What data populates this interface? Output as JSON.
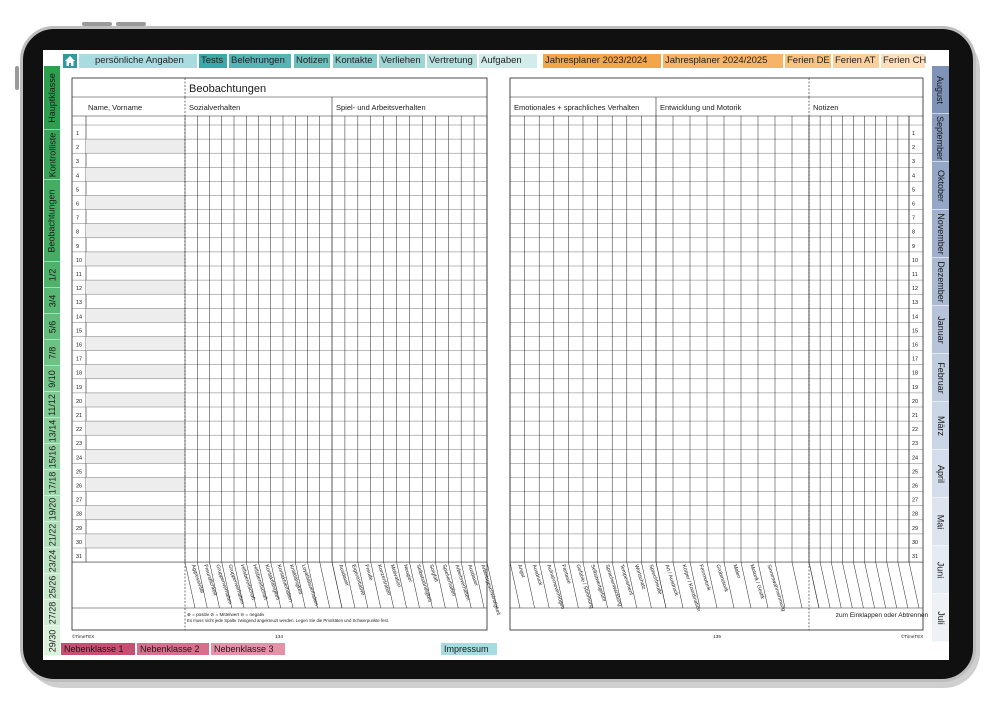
{
  "tabs_top": [
    {
      "label": "persönliche Angaben",
      "color": "#a9dce0"
    },
    {
      "label": "Tests",
      "color": "#39a9a9"
    },
    {
      "label": "Belehrungen",
      "color": "#55b5b5"
    },
    {
      "label": "Notizen",
      "color": "#6bc0bc"
    },
    {
      "label": "Kontakte",
      "color": "#86cbc9"
    },
    {
      "label": "Verliehen",
      "color": "#9fd6d4"
    },
    {
      "label": "Vertretung",
      "color": "#b8e0df"
    },
    {
      "label": "Aufgaben",
      "color": "#d2eceb"
    },
    {
      "label": "Jahresplaner 2023/2024",
      "color": "#f4a54a"
    },
    {
      "label": "Jahresplaner 2024/2025",
      "color": "#f7b466"
    },
    {
      "label": "Ferien DE",
      "color": "#f8c281"
    },
    {
      "label": "Ferien AT",
      "color": "#fad09d"
    },
    {
      "label": "Ferien CH",
      "color": "#fcdfbc"
    }
  ],
  "tabs_left": [
    {
      "label": "Hauptklasse",
      "color": "#2e9e4f"
    },
    {
      "label": "Kontrolliste",
      "color": "#3aa55a"
    },
    {
      "label": "Beobachtungen",
      "color": "#45ac63"
    },
    {
      "label": "1/2",
      "color": "#4eb26b"
    },
    {
      "label": "3/4",
      "color": "#58b773"
    },
    {
      "label": "5/6",
      "color": "#62bc7b"
    },
    {
      "label": "7/8",
      "color": "#6cc183"
    },
    {
      "label": "9/10",
      "color": "#76c68b"
    },
    {
      "label": "11/12",
      "color": "#80cb93"
    },
    {
      "label": "13/14",
      "color": "#8ad09b"
    },
    {
      "label": "15/16",
      "color": "#94d4a3"
    },
    {
      "label": "17/18",
      "color": "#9ed9ab"
    },
    {
      "label": "19/20",
      "color": "#a8ddb3"
    },
    {
      "label": "21/22",
      "color": "#b2e1bb"
    },
    {
      "label": "23/24",
      "color": "#bce5c3"
    },
    {
      "label": "25/26",
      "color": "#c6e9cb"
    },
    {
      "label": "27/28",
      "color": "#d0edd3"
    },
    {
      "label": "29/30",
      "color": "#daf1db"
    }
  ],
  "tabs_right": [
    {
      "label": "August",
      "color": "#7f93b8"
    },
    {
      "label": "September",
      "color": "#8a9dbf"
    },
    {
      "label": "Oktober",
      "color": "#95a7c6"
    },
    {
      "label": "November",
      "color": "#a0b0cc"
    },
    {
      "label": "Dezember",
      "color": "#abbad3"
    },
    {
      "label": "Januar",
      "color": "#b6c3d9"
    },
    {
      "label": "Februar",
      "color": "#c0cddf"
    },
    {
      "label": "März",
      "color": "#cad5e5"
    },
    {
      "label": "April",
      "color": "#d3ddeb"
    },
    {
      "label": "Mai",
      "color": "#dce4ef"
    },
    {
      "label": "Juni",
      "color": "#e5ebf3"
    },
    {
      "label": "Juli",
      "color": "#eef2f7"
    }
  ],
  "tabs_bottom": [
    {
      "label": "Nebenklasse 1",
      "color": "#c94f72"
    },
    {
      "label": "Nebenklasse 2",
      "color": "#d86f8c"
    },
    {
      "label": "Nebenklasse 3",
      "color": "#e592a8"
    },
    {
      "label": "Impressum",
      "color": "#a9dce0"
    }
  ],
  "left_page": {
    "title": "Beobachtungen",
    "col_name": "Name, Vorname",
    "section1": "Sozialverhalten",
    "section2": "Spiel- und Arbeitsverhalten",
    "section1_labels": [
      "Aggressivität",
      "Freundlichkeit",
      "Gruppenverhalten",
      "Gruppenverhalten",
      "Hilfsbereitschaft",
      "Hilfsbereitschaft",
      "Kontaktfähigkeit",
      "Kontaktverhalten",
      "Kritikfähigkeit",
      "Loyalitätsverhalten",
      "",
      ""
    ],
    "section2_labels": [
      "Ausdauer",
      "Eigeninitiative",
      "Freude",
      "Konzentration",
      "Motivation",
      "Neugier",
      "Selbstständigkeit",
      "Sorgfalt",
      "Spielverhalten",
      "Arbeitsverhalten",
      "Ausdauer",
      "Arbeitsgeschwindigkeit"
    ],
    "legend": "⊕ = positiv    ⊘ = Mittelwert    ⊖ = negativ",
    "note": "Es muss nicht jede Spalte zwingend angekreuzt werden. Legen Sie die Prioritäten und Schwerpunkte fest.",
    "copyright": "©TimeTEX",
    "page_number": "134"
  },
  "right_page": {
    "section1": "Emotionales + sprachliches Verhalten",
    "section2": "Entwicklung und Motorik",
    "section3": "Notizen",
    "section1_labels": [
      "Angst",
      "Ausdruck",
      "Aufnahmevermögen",
      "Fantasie",
      "Gefühle / Stimmung",
      "Selbstwertgefühl",
      "Sprachentwicklung",
      "Temperament",
      "Wortschatz",
      "Sprechfreude"
    ],
    "section2_labels": [
      "Art / Ausdruck",
      "Körper / Koordination",
      "Feinmotorik",
      "Grobmotorik",
      "Malen",
      "Motorik / Gestik",
      "Sinneswahrnehmung",
      "",
      ""
    ],
    "footer_text": "zum Einklappen oder Abtrennen",
    "copyright": "©TimeTEX",
    "page_number": "135"
  },
  "row_count": 31
}
